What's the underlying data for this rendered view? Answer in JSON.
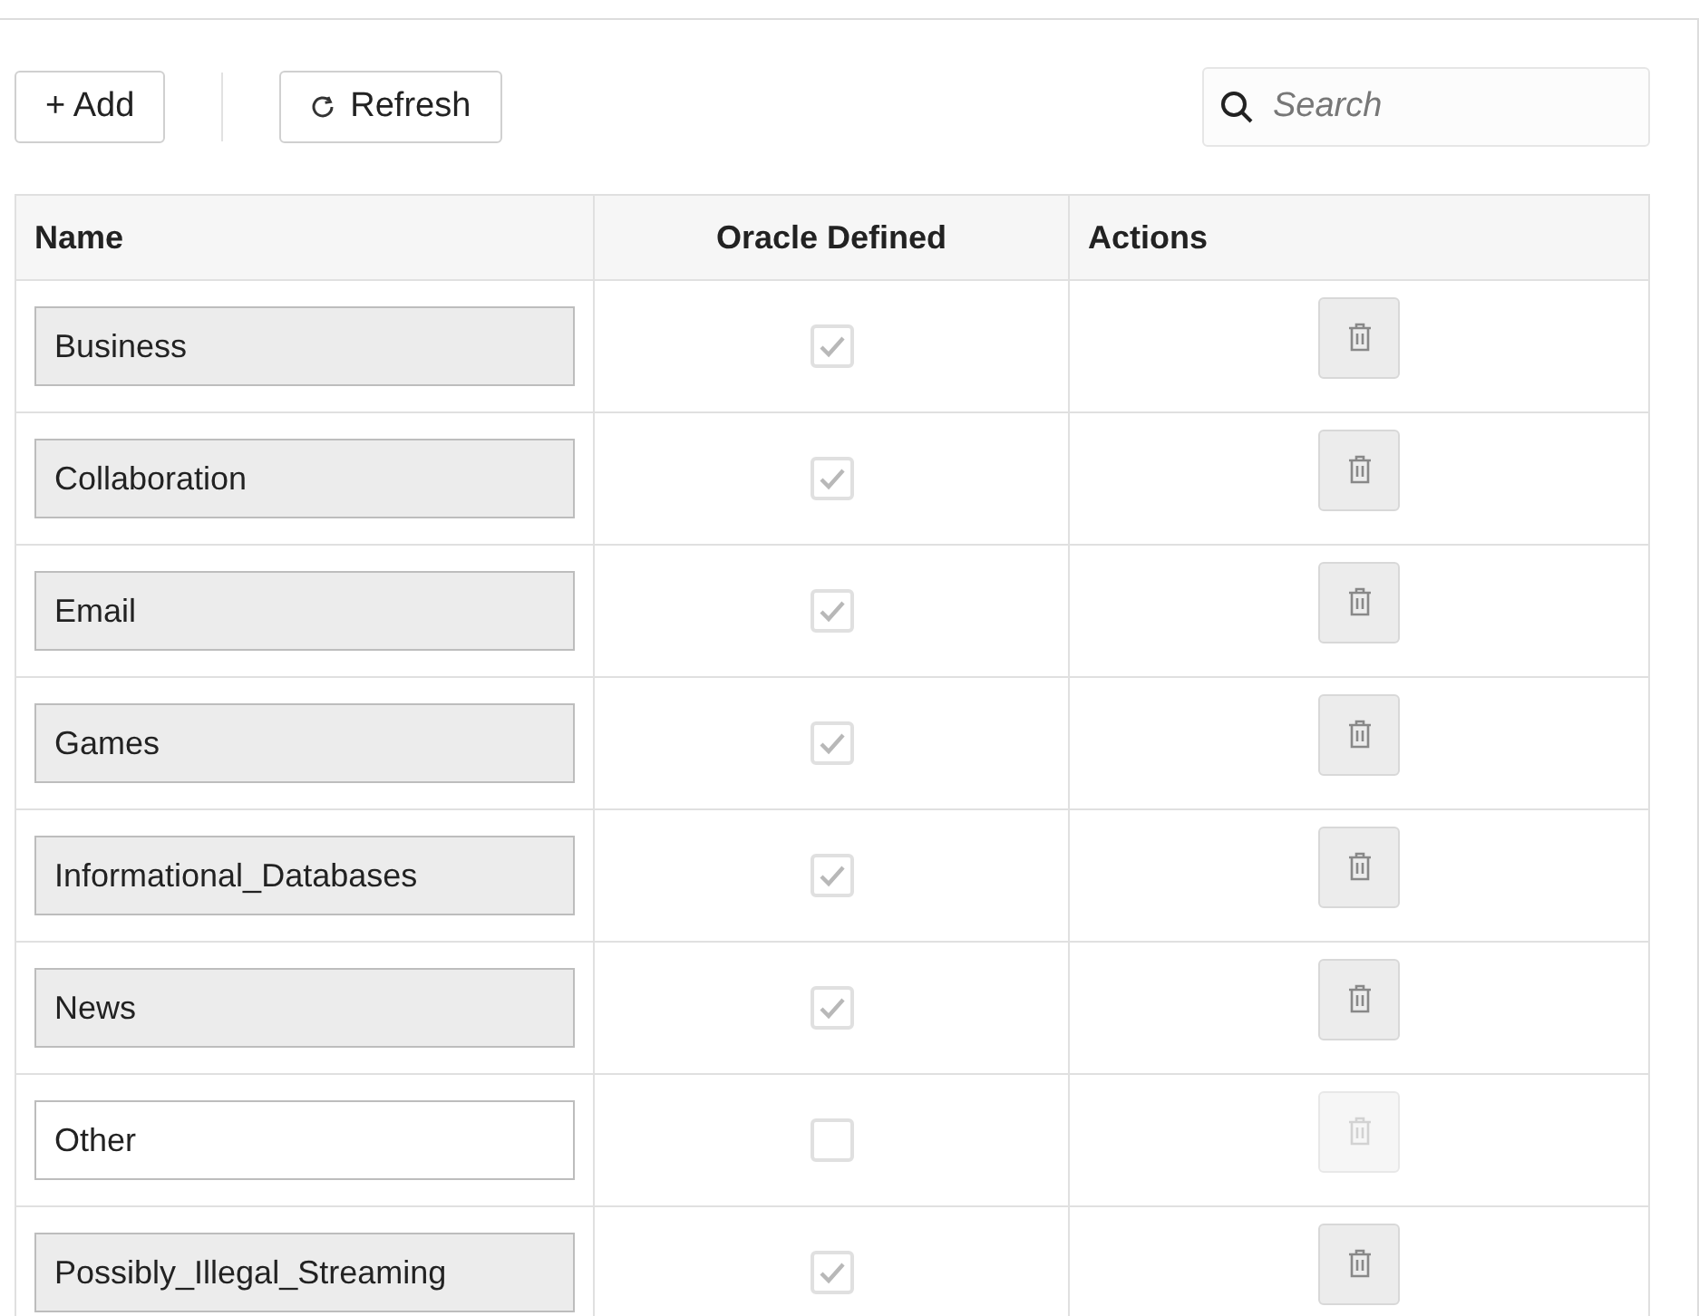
{
  "toolbar": {
    "add_button": "+ Add",
    "refresh_button": "Refresh",
    "search": {
      "placeholder": "Search"
    }
  },
  "table": {
    "columns": [
      "Name",
      "Oracle Defined",
      "Actions"
    ],
    "rows": [
      {
        "name": "Business",
        "editable": false,
        "checked": true,
        "delete_disabled": false
      },
      {
        "name": "Collaboration",
        "editable": false,
        "checked": true,
        "delete_disabled": false
      },
      {
        "name": "Email",
        "editable": false,
        "checked": true,
        "delete_disabled": false
      },
      {
        "name": "Games",
        "editable": false,
        "checked": true,
        "delete_disabled": false
      },
      {
        "name": "Informational_Databases",
        "editable": false,
        "checked": true,
        "delete_disabled": false
      },
      {
        "name": "News",
        "editable": false,
        "checked": true,
        "delete_disabled": false
      },
      {
        "name": "Other",
        "editable": true,
        "checked": false,
        "delete_disabled": true
      },
      {
        "name": "Possibly_Illegal_Streaming",
        "editable": false,
        "checked": true,
        "delete_disabled": false
      }
    ]
  }
}
